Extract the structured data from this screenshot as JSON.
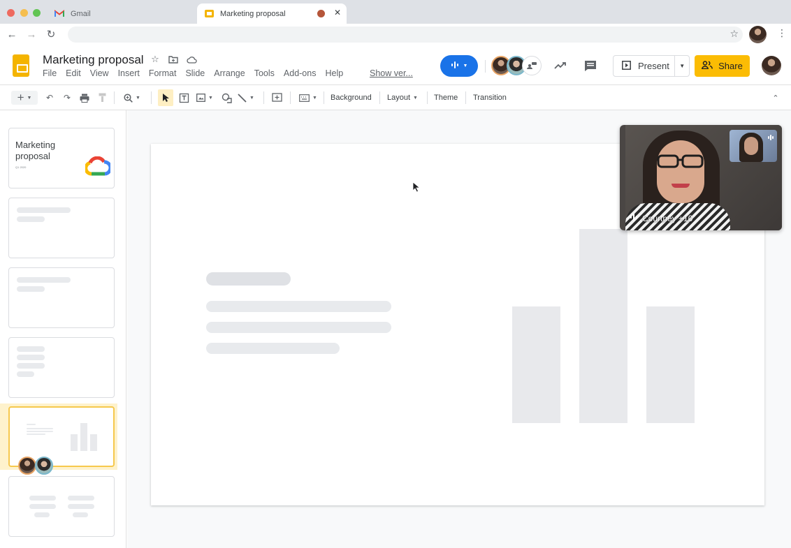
{
  "browser": {
    "tabs": [
      {
        "label": "Gmail",
        "icon": "gmail-icon",
        "active": false
      },
      {
        "label": "Marketing proposal",
        "icon": "slides-icon",
        "active": true,
        "recording_indicator": true
      }
    ],
    "address": "",
    "icons": [
      "back-icon",
      "forward-icon",
      "reload-icon",
      "bookmark-star-icon",
      "profile-avatar",
      "browser-menu-icon"
    ]
  },
  "app": {
    "title": "Marketing proposal",
    "menu": [
      "File",
      "Edit",
      "View",
      "Insert",
      "Format",
      "Slide",
      "Arrange",
      "Tools",
      "Add-ons",
      "Help"
    ],
    "show_versions": "Show ver...",
    "present_label": "Present",
    "share_label": "Share",
    "colors": {
      "meet_blue": "#1a73e8",
      "share_yellow": "#fbbc04",
      "selected_border": "#f6c84c",
      "skeleton": "#e8eaed"
    }
  },
  "toolbar": {
    "background": "Background",
    "layout": "Layout",
    "theme": "Theme",
    "transition": "Transition"
  },
  "filmstrip": {
    "slides": [
      {
        "index": 1,
        "title": "Marketing proposal",
        "subtitle": "Q1 2020",
        "has_logo": true
      },
      {
        "index": 2,
        "placeholder": true
      },
      {
        "index": 3,
        "placeholder": true
      },
      {
        "index": 4,
        "placeholder": true
      },
      {
        "index": 5,
        "placeholder": true,
        "selected": true,
        "collaborators": 2
      },
      {
        "index": 6,
        "placeholder": true
      }
    ]
  },
  "slide": {
    "placeholder_chart": {
      "relative_bar_heights": [
        0.6,
        1.0,
        0.6
      ]
    }
  },
  "meet": {
    "participant_label": "Courtney +10"
  }
}
